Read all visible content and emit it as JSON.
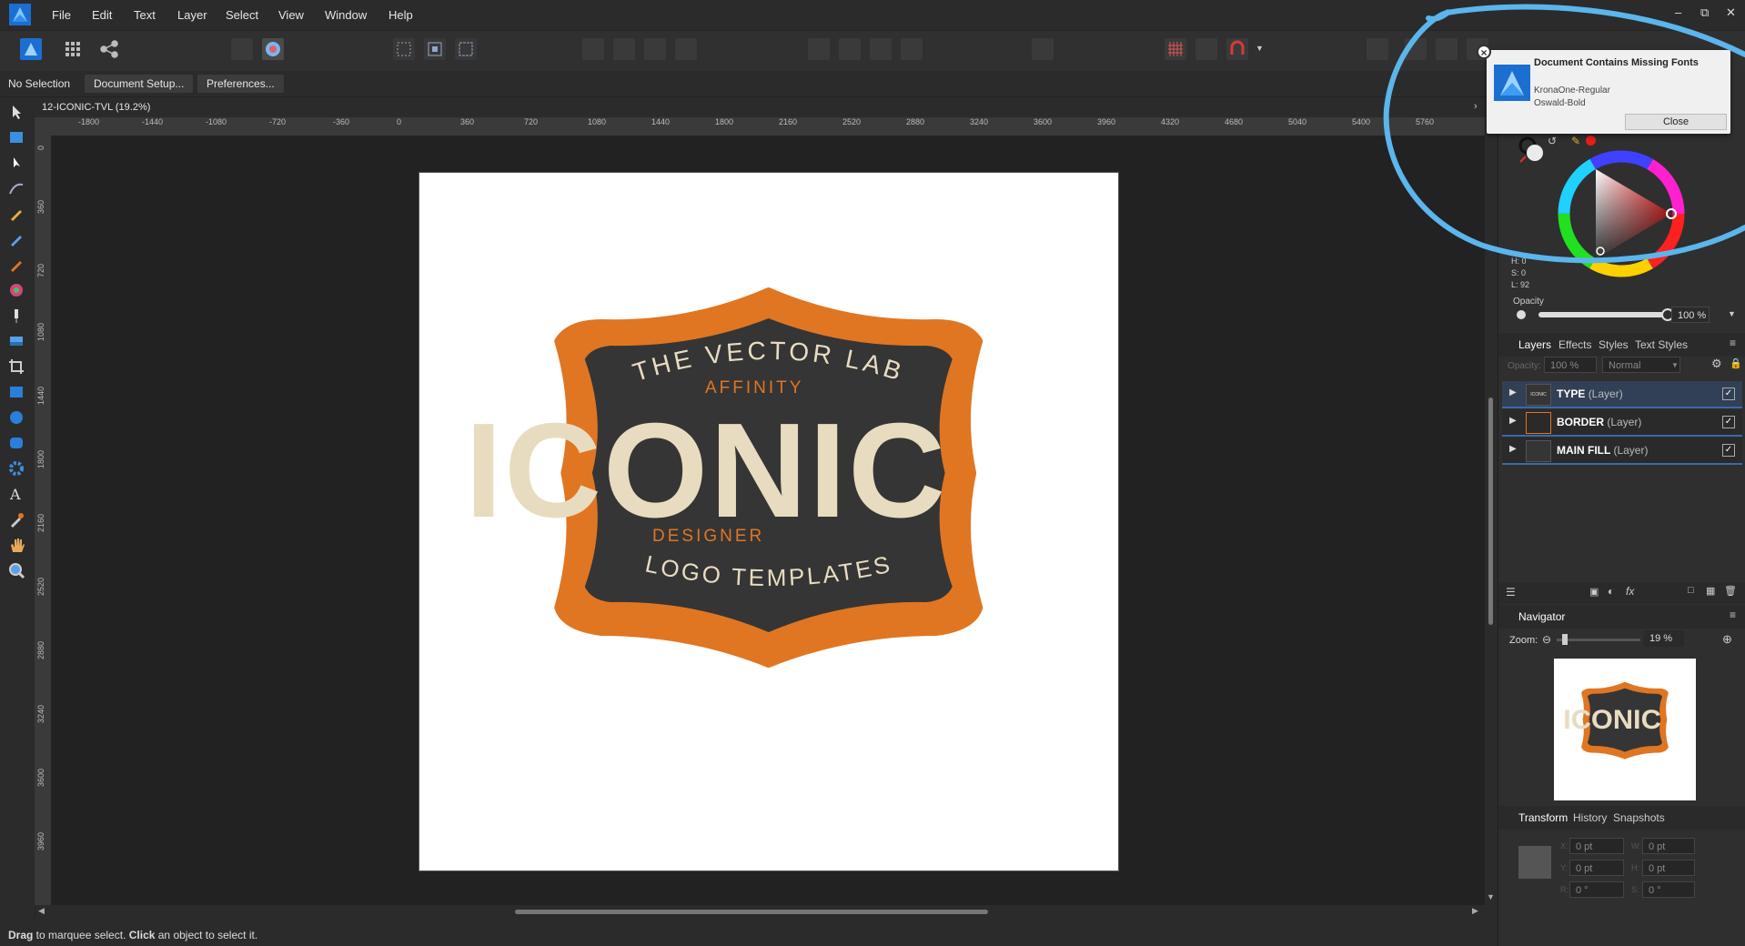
{
  "app": {
    "menu": [
      "File",
      "Edit",
      "Text",
      "Layer",
      "Select",
      "View",
      "Window",
      "Help"
    ],
    "window_controls": [
      "minimize",
      "restore",
      "close"
    ]
  },
  "context_bar": {
    "selection": "No Selection",
    "document_setup": "Document Setup...",
    "preferences": "Preferences..."
  },
  "document": {
    "tab_title": "12-ICONIC-TVL (19.2%)",
    "h_ruler": [
      "-1800",
      "-1440",
      "-1080",
      "-720",
      "-360",
      "0",
      "360",
      "720",
      "1080",
      "1440",
      "1800",
      "2160",
      "2520",
      "2880",
      "3240",
      "3600",
      "3960",
      "4320",
      "4680",
      "5040",
      "5400",
      "5760"
    ],
    "v_ruler": [
      "0",
      "360",
      "720",
      "1080",
      "1440",
      "1800",
      "2160",
      "2520",
      "2880",
      "3240",
      "3600",
      "3960"
    ]
  },
  "artwork": {
    "line1": "THE VECTOR LAB",
    "line2": "AFFINITY",
    "main": "ICONIC",
    "line3": "DESIGNER",
    "line4": "LOGO TEMPLATES",
    "colors": {
      "orange": "#e07622",
      "dark": "#353535",
      "cream": "#e8dcc0"
    }
  },
  "notification": {
    "title": "Document Contains Missing Fonts",
    "fonts": [
      "KronaOne-Regular",
      "Oswald-Bold"
    ],
    "close_label": "Close"
  },
  "color_panel": {
    "h": "H: 0",
    "s": "S: 0",
    "l": "L: 92",
    "opacity_label": "Opacity",
    "opacity_value": "100 %",
    "opacity_level": 1.0,
    "selected_color": "#e81c1c"
  },
  "layers_panel": {
    "tabs": [
      "Layers",
      "Effects",
      "Styles",
      "Text Styles"
    ],
    "opacity_label": "Opacity:",
    "opacity_value": "100 %",
    "blend_mode": "Normal",
    "layers": [
      {
        "name": "TYPE",
        "type": "(Layer)",
        "visible": true
      },
      {
        "name": "BORDER",
        "type": "(Layer)",
        "visible": true
      },
      {
        "name": "MAIN FILL",
        "type": "(Layer)",
        "visible": true
      }
    ]
  },
  "navigator": {
    "title": "Navigator",
    "zoom_label": "Zoom:",
    "zoom_value": "19 %",
    "thumb_text": "ICONIC"
  },
  "transform_panel": {
    "tabs": [
      "Transform",
      "History",
      "Snapshots"
    ],
    "x_label": "X:",
    "y_label": "Y:",
    "w_label": "W:",
    "h_label": "H:",
    "r_label": "R:",
    "s_label": "S:",
    "x": "0 pt",
    "y": "0 pt",
    "w": "0 pt",
    "h": "0 pt",
    "r": "0 °",
    "s": "0 °"
  },
  "status": {
    "drag": "Drag",
    "drag_text": " to marquee select. ",
    "click": "Click",
    "click_text": " an object to select it."
  }
}
